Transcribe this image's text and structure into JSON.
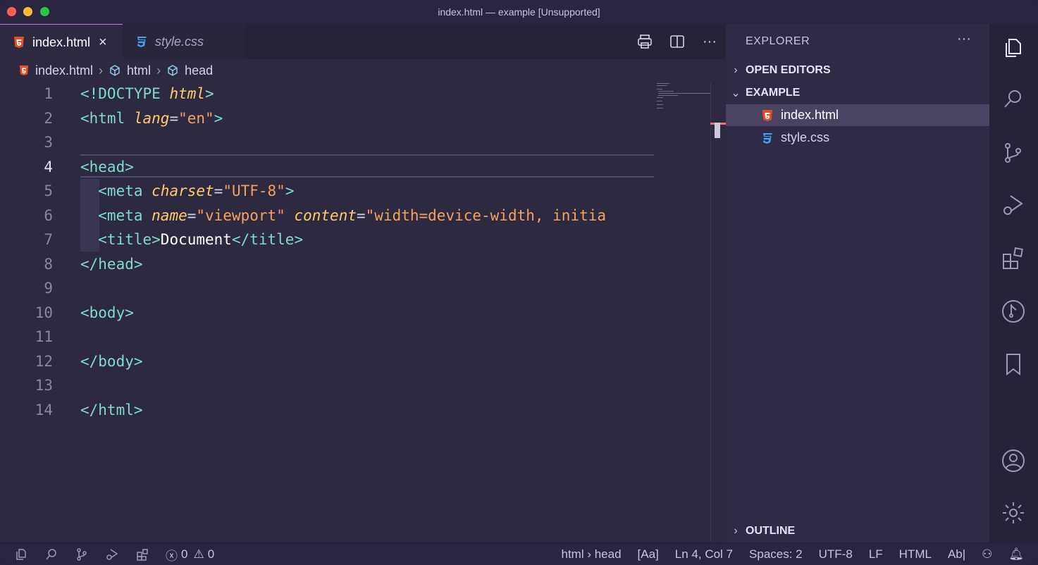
{
  "window": {
    "title": "index.html — example [Unsupported]"
  },
  "tabs": [
    {
      "label": "index.html",
      "active": true,
      "icon": "html5-icon"
    },
    {
      "label": "style.css",
      "active": false,
      "icon": "css3-icon"
    }
  ],
  "editor_actions": [
    "print-icon",
    "split-editor-icon",
    "more-actions-icon"
  ],
  "breadcrumb": [
    "index.html",
    "html",
    "head"
  ],
  "editor": {
    "current_line": 4,
    "line_numbers": [
      "1",
      "2",
      "3",
      "4",
      "5",
      "6",
      "7",
      "8",
      "9",
      "10",
      "11",
      "12",
      "13",
      "14"
    ],
    "lines": {
      "l1_open": "<!DOCTYPE ",
      "l1_attr": "html",
      "l1_close": ">",
      "l2_tag": "<html ",
      "l2_attr": "lang",
      "l2_eq": "=",
      "l2_str": "\"en\"",
      "l2_close": ">",
      "l4_tag": "<head>",
      "l5_tag": "  <meta ",
      "l5_attr": "charset",
      "l5_eq": "=",
      "l5_str": "\"UTF-8\"",
      "l5_close": ">",
      "l6_tag": "  <meta ",
      "l6_attr1": "name",
      "l6_eq1": "=",
      "l6_str1": "\"viewport\"",
      "l6_sp": " ",
      "l6_attr2": "content",
      "l6_eq2": "=",
      "l6_str2": "\"width=device-width, initia",
      "l7_open": "  <title>",
      "l7_text": "Document",
      "l7_close": "</title>",
      "l8_tag": "</head>",
      "l10_tag": "<body>",
      "l12_tag": "</body>",
      "l14_tag": "</html>"
    }
  },
  "sidebar": {
    "header": "EXPLORER",
    "sections": {
      "open_editors": "OPEN EDITORS",
      "example": "EXAMPLE",
      "outline": "OUTLINE"
    },
    "files": [
      {
        "name": "index.html",
        "selected": true
      },
      {
        "name": "style.css",
        "selected": false
      }
    ]
  },
  "activity_bar": [
    "explorer-icon",
    "search-icon",
    "source-control-icon",
    "run-debug-icon",
    "extensions-icon",
    "git-graph-icon",
    "bookmarks-icon",
    "account-icon",
    "settings-gear-icon"
  ],
  "status_bar": {
    "errors": "0",
    "warnings": "0",
    "breadcrumb": "html › head",
    "case": "[Aa]",
    "position": "Ln 4, Col 7",
    "spaces": "Spaces: 2",
    "encoding": "UTF-8",
    "eol": "LF",
    "language": "HTML",
    "spell": "Ab|"
  },
  "colors": {
    "tag": "#7fdbca",
    "attribute": "#ffcb6b",
    "string": "#f5a25d",
    "html_icon": "#e44d26",
    "css_icon": "#42a5f5"
  }
}
